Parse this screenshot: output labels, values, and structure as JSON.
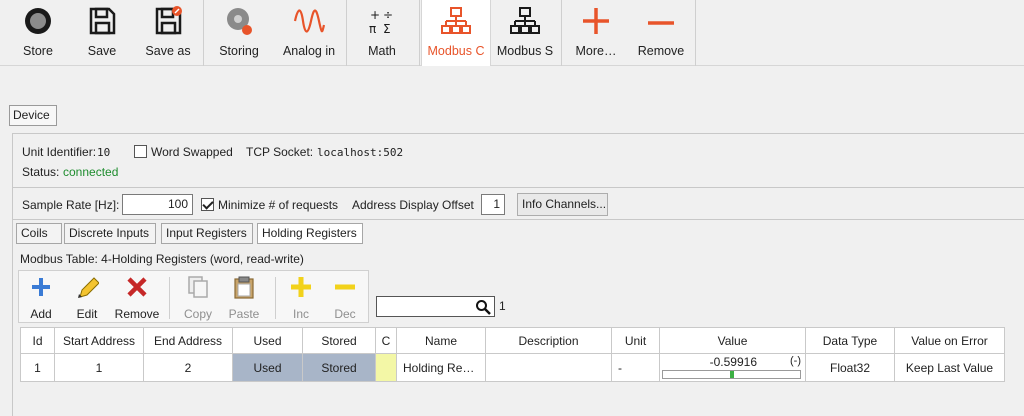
{
  "toolbar": {
    "buttons": [
      {
        "label": "Store",
        "icon": "record-icon"
      },
      {
        "label": "Save",
        "icon": "save-icon"
      },
      {
        "label": "Save as",
        "icon": "save-as-icon"
      },
      {
        "label": "Storing",
        "icon": "storing-icon"
      },
      {
        "label": "Analog in",
        "icon": "analog-wave-icon"
      },
      {
        "label": "Math",
        "icon": "math-icon"
      },
      {
        "label": "Modbus C",
        "icon": "network-icon"
      },
      {
        "label": "Modbus S",
        "icon": "network-icon"
      },
      {
        "label": "More…",
        "icon": "plus-icon"
      },
      {
        "label": "Remove",
        "icon": "minus-icon"
      }
    ],
    "active": "Modbus C",
    "accent": "#e8542a"
  },
  "device_tab": "Device",
  "device": {
    "unit_identifier_label": "Unit Identifier:",
    "unit_identifier_value": "10",
    "word_swapped_label": "Word Swapped",
    "word_swapped": false,
    "tcp_socket_label": "TCP Socket:",
    "tcp_socket_value": "localhost:502",
    "status_label": "Status:",
    "status_value": "connected",
    "status_color": "#1e8c2e"
  },
  "settings": {
    "sample_rate_label": "Sample Rate [Hz]:",
    "sample_rate_value": "100",
    "minimize_label": "Minimize # of requests",
    "minimize_checked": true,
    "address_offset_label": "Address Display Offset",
    "address_offset_value": "1",
    "info_channels_button": "Info Channels..."
  },
  "register_tabs": [
    "Coils",
    "Discrete Inputs",
    "Input Registers",
    "Holding Registers"
  ],
  "register_tab_selected": "Holding Registers",
  "modbus_table_label": "Modbus Table: 4-Holding Registers (word, read-write)",
  "table_toolbar": {
    "add": "Add",
    "edit": "Edit",
    "remove": "Remove",
    "copy": "Copy",
    "paste": "Paste",
    "inc": "Inc",
    "dec": "Dec"
  },
  "search": {
    "value": "",
    "result_count": "1"
  },
  "table": {
    "columns": [
      "Id",
      "Start Address",
      "End Address",
      "Used",
      "Stored",
      "C",
      "Name",
      "Description",
      "Unit",
      "Value",
      "Data Type",
      "Value on Error"
    ],
    "rows": [
      {
        "id": "1",
        "start_address": "1",
        "end_address": "2",
        "used": "Used",
        "stored": "Stored",
        "c": "",
        "name": "Holding Re…",
        "description": "",
        "unit": "-",
        "value": "-0.59916",
        "value_tag": "(-)",
        "value_level": 0.5,
        "data_type": "Float32",
        "value_on_error": "Keep Last Value"
      }
    ]
  }
}
